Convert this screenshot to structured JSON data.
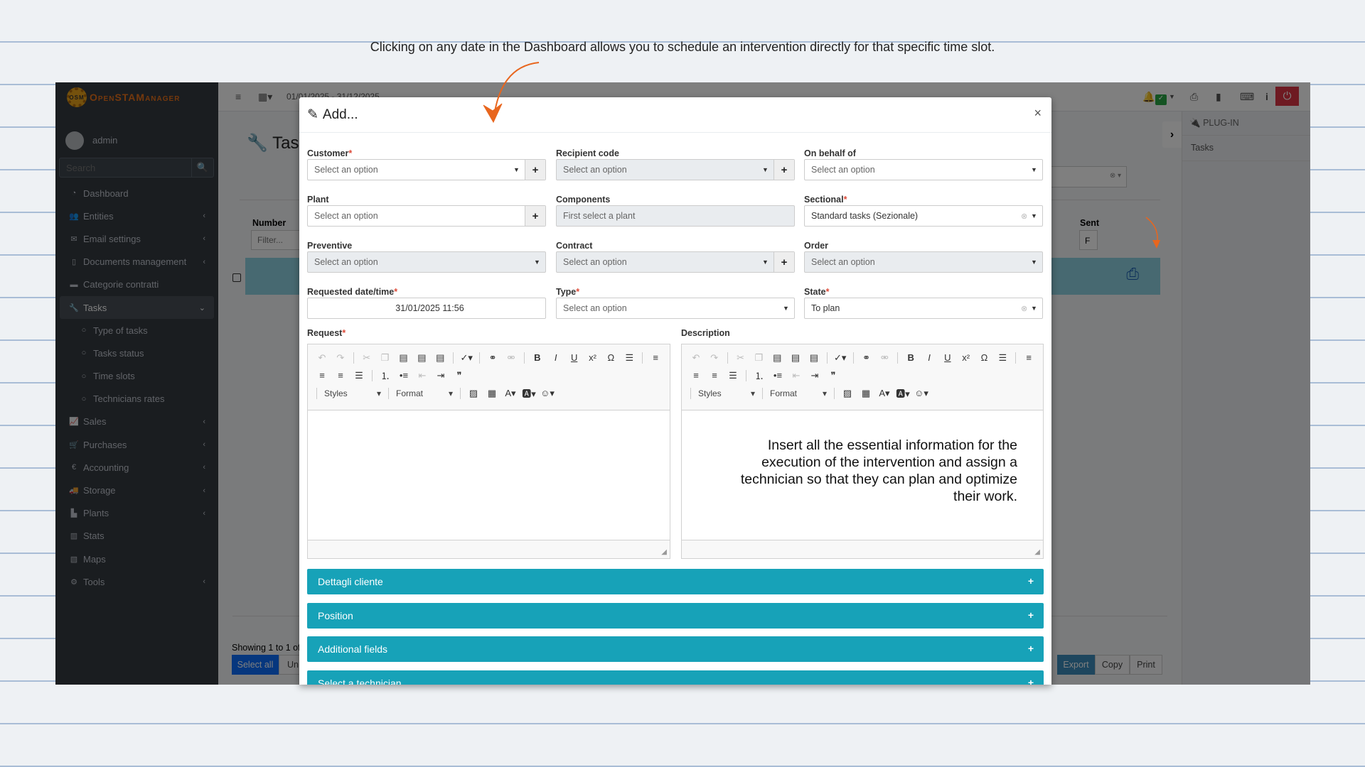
{
  "caption": "Clicking on any date in the Dashboard allows you to schedule an intervention directly for that specific time slot.",
  "brand": {
    "logo_text": "OpenSTAManager",
    "logo_badge": "OSM"
  },
  "user": {
    "name": "admin"
  },
  "sidebar": {
    "search_placeholder": "Search",
    "items": [
      {
        "label": "Dashboard",
        "icon": "dashboard-icon",
        "glyph": "◔",
        "chevron": false
      },
      {
        "label": "Entities",
        "icon": "users-icon",
        "glyph": "👥",
        "chevron": true
      },
      {
        "label": "Email settings",
        "icon": "envelope-icon",
        "glyph": "✉",
        "chevron": true
      },
      {
        "label": "Documents management",
        "icon": "file-icon",
        "glyph": "▯",
        "chevron": true
      },
      {
        "label": "Categorie contratti",
        "icon": "briefcase-icon",
        "glyph": "▬",
        "chevron": false
      },
      {
        "label": "Tasks",
        "icon": "wrench-icon",
        "glyph": "🔧",
        "chevron": "down",
        "active": true
      },
      {
        "label": "Type of tasks",
        "icon": "circle-icon",
        "glyph": "○",
        "sub": true
      },
      {
        "label": "Tasks status",
        "icon": "circle-icon",
        "glyph": "○",
        "sub": true
      },
      {
        "label": "Time slots",
        "icon": "circle-icon",
        "glyph": "○",
        "sub": true
      },
      {
        "label": "Technicians rates",
        "icon": "circle-icon",
        "glyph": "○",
        "sub": true
      },
      {
        "label": "Sales",
        "icon": "line-chart-icon",
        "glyph": "📈",
        "chevron": true
      },
      {
        "label": "Purchases",
        "icon": "cart-icon",
        "glyph": "🛒",
        "chevron": true
      },
      {
        "label": "Accounting",
        "icon": "euro-icon",
        "glyph": "€",
        "chevron": true
      },
      {
        "label": "Storage",
        "icon": "truck-icon",
        "glyph": "🚚",
        "chevron": true
      },
      {
        "label": "Plants",
        "icon": "industry-icon",
        "glyph": "▙",
        "chevron": true
      },
      {
        "label": "Stats",
        "icon": "bar-chart-icon",
        "glyph": "▥",
        "chevron": false
      },
      {
        "label": "Maps",
        "icon": "map-icon",
        "glyph": "▧",
        "chevron": false
      },
      {
        "label": "Tools",
        "icon": "cog-icon",
        "glyph": "⚙",
        "chevron": true
      }
    ]
  },
  "topbar": {
    "date_range": "01/01/2025 - 31/12/2025"
  },
  "page": {
    "title": "Tasks",
    "columns": {
      "number": "Number",
      "sent": "Sent"
    },
    "filter_placeholder": "Filter...",
    "sent_filter": "F",
    "showing": "Showing 1 to 1 of",
    "buttons": {
      "select_all": "Select all",
      "unselect": "Un",
      "export": "Export",
      "copy": "Copy",
      "print": "Print"
    }
  },
  "right_panel": {
    "header": "PLUG-IN",
    "item": "Tasks"
  },
  "modal": {
    "title": "Add...",
    "fields": {
      "customer": {
        "label": "Customer",
        "required": true,
        "value": "",
        "placeholder": "Select an option"
      },
      "recipient_code": {
        "label": "Recipient code",
        "placeholder": "Select an option"
      },
      "on_behalf_of": {
        "label": "On behalf of",
        "placeholder": "Select an option"
      },
      "plant": {
        "label": "Plant",
        "placeholder": "Select an option"
      },
      "components": {
        "label": "Components",
        "placeholder": "First select a plant"
      },
      "sectional": {
        "label": "Sectional",
        "required": true,
        "value": "Standard tasks (Sezionale)"
      },
      "preventive": {
        "label": "Preventive",
        "placeholder": "Select an option"
      },
      "contract": {
        "label": "Contract",
        "placeholder": "Select an option"
      },
      "order": {
        "label": "Order",
        "placeholder": "Select an option"
      },
      "requested_datetime": {
        "label": "Requested date/time",
        "required": true,
        "value": "31/01/2025 11:56"
      },
      "type": {
        "label": "Type",
        "required": true,
        "placeholder": "Select an option"
      },
      "state": {
        "label": "State",
        "required": true,
        "value": "To plan"
      }
    },
    "request": {
      "label": "Request",
      "required": true,
      "content": ""
    },
    "description": {
      "label": "Description",
      "content": "Insert all the essential information for the execution of the intervention and assign a technician so that they can plan and optimize their work."
    },
    "editor_toolbar": {
      "styles": "Styles",
      "format": "Format"
    },
    "accordions": [
      "Dettagli cliente",
      "Position",
      "Additional fields",
      "Select a technician"
    ]
  },
  "colors": {
    "accent": "#17a2b8",
    "annotation": "#e8661e",
    "danger": "#dc3545",
    "success": "#28a745"
  }
}
